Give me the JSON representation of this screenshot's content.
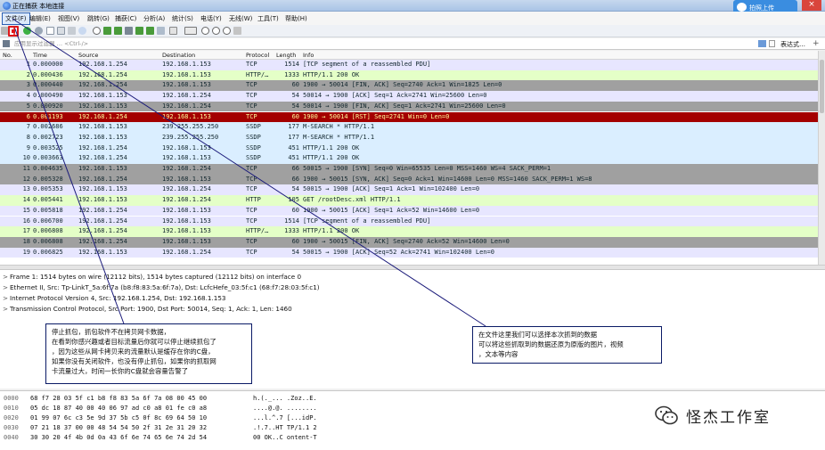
{
  "window": {
    "title": "正在捕获 本地连接"
  },
  "cloud_button": {
    "label": "拍照上传"
  },
  "menu": [
    "文件(F)",
    "编辑(E)",
    "视图(V)",
    "跳转(G)",
    "捕获(C)",
    "分析(A)",
    "统计(S)",
    "电话(Y)",
    "无线(W)",
    "工具(T)",
    "帮助(H)"
  ],
  "filter": {
    "placeholder": "应用显示过滤器 … <Ctrl-/>",
    "expression_button": "表达式…",
    "plus": "+"
  },
  "columns": {
    "no": "No.",
    "time": "Time",
    "source": "Source",
    "destination": "Destination",
    "protocol": "Protocol",
    "length": "Length",
    "info": "Info"
  },
  "packets": [
    {
      "no": "1",
      "time": "0.000000",
      "src": "192.168.1.254",
      "dst": "192.168.1.153",
      "proto": "TCP",
      "len": "1514",
      "info": "[TCP segment of a reassembled PDU]",
      "bg": "#e7e6ff",
      "fg": "#12272e"
    },
    {
      "no": "2",
      "time": "0.000436",
      "src": "192.168.1.254",
      "dst": "192.168.1.153",
      "proto": "HTTP/…",
      "len": "1333",
      "info": "HTTP/1.1 200 OK",
      "bg": "#e4ffc7",
      "fg": "#12272e"
    },
    {
      "no": "3",
      "time": "0.000440",
      "src": "192.168.1.254",
      "dst": "192.168.1.153",
      "proto": "TCP",
      "len": "60",
      "info": "1900 → 50014 [FIN, ACK] Seq=2740 Ack=1 Win=1825 Len=0",
      "bg": "#a0a0a0",
      "fg": "#12272e"
    },
    {
      "no": "4",
      "time": "0.000490",
      "src": "192.168.1.153",
      "dst": "192.168.1.254",
      "proto": "TCP",
      "len": "54",
      "info": "50014 → 1900 [ACK] Seq=1 Ack=2741 Win=25600 Len=0",
      "bg": "#e7e6ff",
      "fg": "#12272e"
    },
    {
      "no": "5",
      "time": "0.000920",
      "src": "192.168.1.153",
      "dst": "192.168.1.254",
      "proto": "TCP",
      "len": "54",
      "info": "50014 → 1900 [FIN, ACK] Seq=1 Ack=2741 Win=25600 Len=0",
      "bg": "#a0a0a0",
      "fg": "#12272e"
    },
    {
      "no": "6",
      "time": "0.001193",
      "src": "192.168.1.254",
      "dst": "192.168.1.153",
      "proto": "TCP",
      "len": "60",
      "info": "1900 → 50014 [RST] Seq=2741 Win=0 Len=0",
      "bg": "#a40000",
      "fg": "#fffc9c"
    },
    {
      "no": "7",
      "time": "0.002686",
      "src": "192.168.1.153",
      "dst": "239.255.255.250",
      "proto": "SSDP",
      "len": "177",
      "info": "M-SEARCH * HTTP/1.1",
      "bg": "#daeeff",
      "fg": "#12272e"
    },
    {
      "no": "8",
      "time": "0.002723",
      "src": "192.168.1.153",
      "dst": "239.255.255.250",
      "proto": "SSDP",
      "len": "177",
      "info": "M-SEARCH * HTTP/1.1",
      "bg": "#daeeff",
      "fg": "#12272e"
    },
    {
      "no": "9",
      "time": "0.003525",
      "src": "192.168.1.254",
      "dst": "192.168.1.153",
      "proto": "SSDP",
      "len": "451",
      "info": "HTTP/1.1 200 OK",
      "bg": "#daeeff",
      "fg": "#12272e"
    },
    {
      "no": "10",
      "time": "0.003663",
      "src": "192.168.1.254",
      "dst": "192.168.1.153",
      "proto": "SSDP",
      "len": "451",
      "info": "HTTP/1.1 200 OK",
      "bg": "#daeeff",
      "fg": "#12272e"
    },
    {
      "no": "11",
      "time": "0.004635",
      "src": "192.168.1.153",
      "dst": "192.168.1.254",
      "proto": "TCP",
      "len": "66",
      "info": "50015 → 1900 [SYN] Seq=0 Win=65535 Len=0 MSS=1460 WS=4 SACK_PERM=1",
      "bg": "#a0a0a0",
      "fg": "#12272e"
    },
    {
      "no": "12",
      "time": "0.005328",
      "src": "192.168.1.254",
      "dst": "192.168.1.153",
      "proto": "TCP",
      "len": "66",
      "info": "1900 → 50015 [SYN, ACK] Seq=0 Ack=1 Win=14600 Len=0 MSS=1460 SACK_PERM=1 WS=8",
      "bg": "#a0a0a0",
      "fg": "#12272e"
    },
    {
      "no": "13",
      "time": "0.005353",
      "src": "192.168.1.153",
      "dst": "192.168.1.254",
      "proto": "TCP",
      "len": "54",
      "info": "50015 → 1900 [ACK] Seq=1 Ack=1 Win=102400 Len=0",
      "bg": "#e7e6ff",
      "fg": "#12272e"
    },
    {
      "no": "14",
      "time": "0.005441",
      "src": "192.168.1.153",
      "dst": "192.168.1.254",
      "proto": "HTTP",
      "len": "105",
      "info": "GET /rootDesc.xml HTTP/1.1",
      "bg": "#e4ffc7",
      "fg": "#12272e"
    },
    {
      "no": "15",
      "time": "0.005818",
      "src": "192.168.1.254",
      "dst": "192.168.1.153",
      "proto": "TCP",
      "len": "60",
      "info": "1900 → 50015 [ACK] Seq=1 Ack=52 Win=14600 Len=0",
      "bg": "#e7e6ff",
      "fg": "#12272e"
    },
    {
      "no": "16",
      "time": "0.006700",
      "src": "192.168.1.254",
      "dst": "192.168.1.153",
      "proto": "TCP",
      "len": "1514",
      "info": "[TCP segment of a reassembled PDU]",
      "bg": "#e7e6ff",
      "fg": "#12272e"
    },
    {
      "no": "17",
      "time": "0.006808",
      "src": "192.168.1.254",
      "dst": "192.168.1.153",
      "proto": "HTTP/…",
      "len": "1333",
      "info": "HTTP/1.1 200 OK",
      "bg": "#e4ffc7",
      "fg": "#12272e"
    },
    {
      "no": "18",
      "time": "0.006808",
      "src": "192.168.1.254",
      "dst": "192.168.1.153",
      "proto": "TCP",
      "len": "60",
      "info": "1900 → 50015 [FIN, ACK] Seq=2740 Ack=52 Win=14600 Len=0",
      "bg": "#a0a0a0",
      "fg": "#12272e"
    },
    {
      "no": "19",
      "time": "0.006825",
      "src": "192.168.1.153",
      "dst": "192.168.1.254",
      "proto": "TCP",
      "len": "54",
      "info": "50015 → 1900 [ACK] Seq=52 Ack=2741 Win=102400 Len=0",
      "bg": "#e7e6ff",
      "fg": "#12272e"
    }
  ],
  "details": [
    "Frame 1: 1514 bytes on wire (12112 bits), 1514 bytes captured (12112 bits) on interface 0",
    "Ethernet II, Src: Tp-LinkT_5a:6f:7a (b8:f8:83:5a:6f:7a), Dst: LcfcHefe_03:5f:c1 (68:f7:28:03:5f:c1)",
    "Internet Protocol Version 4, Src: 192.168.1.254, Dst: 192.168.1.153",
    "Transmission Control Protocol, Src Port: 1900, Dst Port: 50014, Seq: 1, Ack: 1, Len: 1460"
  ],
  "bytes": [
    {
      "off": "0000",
      "hex": "68 f7 28 03 5f c1 b8 f8  83 5a 6f 7a 08 00 45 00",
      "asc": "h.(._... .Zoz..E."
    },
    {
      "off": "0010",
      "hex": "05 dc 18 87 40 00 40 06  97 ad c0 a8 01 fe c0 a8",
      "asc": "....@.@. ........"
    },
    {
      "off": "0020",
      "hex": "01 99 07 6c c3 5e 9d 37  5b c5 0f 8c 69 64 50 10",
      "asc": "...l.^.7 [...idP."
    },
    {
      "off": "0030",
      "hex": "07 21 18 37 00 00 48 54  54 50 2f 31 2e 31 20 32",
      "asc": ".!.7..HT TP/1.1 2"
    },
    {
      "off": "0040",
      "hex": "30 30 20 4f 4b 0d 0a 43  6f 6e 74 65 6e 74 2d 54",
      "asc": "00 OK..C ontent-T"
    }
  ],
  "annotations": {
    "left": [
      "停止抓包，抓包软件不在拷贝网卡数据，",
      "在看到你感兴趣或者目标流量后你就可以停止继续抓包了",
      "，因为这些从网卡拷贝来的流量默认是缓存在你的C盘，",
      "如果你没有关闭软件，也没有停止抓包，如果你的抓取网",
      "卡流量过大，时间一长你的C盘就会容量告警了"
    ],
    "right": [
      "在文件这里我们可以选择本次抓到的数据",
      "可以将这些抓取到的数据还原为原版的图片，视频",
      "，文本等内容"
    ]
  },
  "watermark": {
    "text": "怪杰工作室"
  },
  "colors": {
    "arrow": "#1a1a7a",
    "selected_row": "#a40000"
  }
}
